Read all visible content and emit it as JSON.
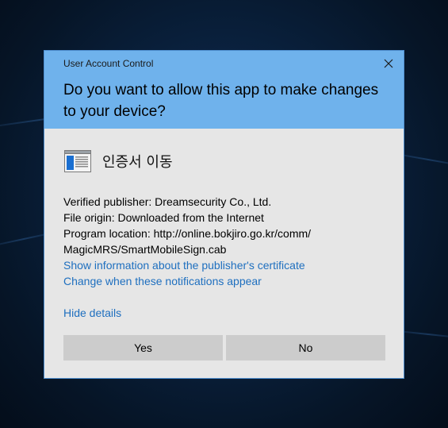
{
  "dialog": {
    "title": "User Account Control",
    "question": "Do you want to allow this app to make changes to your device?",
    "app_name": "인증서 이동",
    "app_icon": "program-window-icon",
    "details": {
      "publisher": "Verified publisher: Dreamsecurity Co., Ltd.",
      "origin": "File origin: Downloaded from the Internet",
      "location_line1": "Program location: http://online.bokjiro.go.kr/comm/",
      "location_line2": "MagicMRS/SmartMobileSign.cab"
    },
    "links": {
      "certificate": "Show information about the publisher's certificate",
      "notifications": "Change when these notifications appear",
      "hide_details": "Hide details"
    },
    "buttons": {
      "yes": "Yes",
      "no": "No"
    }
  },
  "colors": {
    "header": "#6fb2ec",
    "body": "#e6e6e6",
    "link": "#1e6fbf",
    "button": "#cccccc",
    "border": "#4f8fd0"
  }
}
